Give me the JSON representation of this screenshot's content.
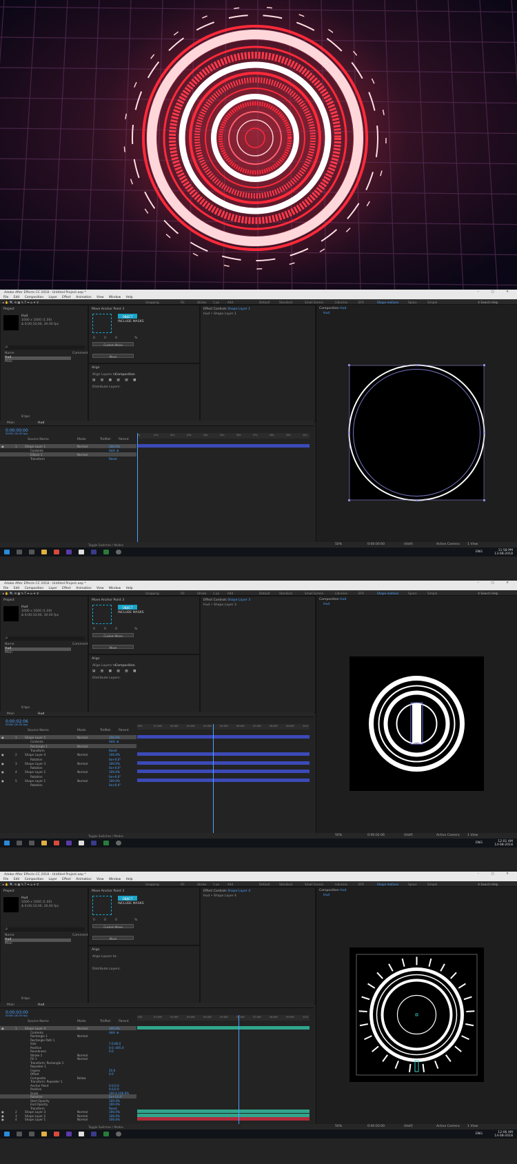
{
  "window_title": "Adobe After Effects CC 2018 - Untitled Project.aep *",
  "menu": [
    "File",
    "Edit",
    "Composition",
    "Layer",
    "Effect",
    "Animation",
    "View",
    "Window",
    "Help"
  ],
  "toolbar": {
    "snapping": "Snapping",
    "fill": "Fill",
    "stroke": "Stroke",
    "stroke_width": "1 px",
    "add": "Add"
  },
  "workspaces": [
    "Default",
    "Standard",
    "Small Screen",
    "Libraries",
    "EFX",
    "Shape motions",
    "Space",
    "Simple"
  ],
  "search_placeholder": "Search Help",
  "project": {
    "tab": "Project",
    "comp_name": "Hud",
    "comp_info": "1000 x 1000 (1.00)",
    "comp_dur": "Δ 0;00;10;00, 30.00 fps",
    "search": "ρ.",
    "col_name": "Name",
    "col_comment": "Comment",
    "items": [
      "Hud",
      "Main"
    ],
    "bpc": "8 bpc"
  },
  "anchor": {
    "title": "Move Anchor Point 3",
    "object": "OBJECT",
    "include_masks": "INCLUDE MASKS",
    "x": "0",
    "y": "0",
    "z": "0",
    "pct": "%",
    "custom": "Custom Move",
    "move": "Move"
  },
  "align": {
    "title": "Align",
    "align_to": "Align Layers to:",
    "composition": "Composition",
    "distribute": "Distribute Layers:"
  },
  "effect_controls": {
    "title": "Effect Controls",
    "shot1_layer": "Shape Layer 1",
    "shot2_layer": "Shape Layer 3",
    "shot3_layer": "Shape Layer 4",
    "shot1_sub": "Hud • Shape Layer 1",
    "shot2_sub": "Hud • Shape Layer 3",
    "shot3_sub": "Hud • Shape Layer 4"
  },
  "composition": {
    "title": "Composition",
    "comp": "Hud",
    "tab": "Hud"
  },
  "timeline": {
    "tabs": [
      "Main",
      "Hud"
    ],
    "col_source": "Source Name",
    "col_mode": "Mode",
    "col_trkmat": "TrkMat",
    "col_parent": "Parent",
    "shot1_time": "0:00:00:00",
    "shot2_time": "0:00:02:06",
    "shot3_time": "0:00:03:00",
    "fps_note": "00000 (30.00 fps)",
    "ruler": [
      "0s",
      "01s",
      "02s",
      "03s",
      "04s",
      "05s",
      "06s",
      "07s",
      "08s",
      "09s",
      "10s"
    ],
    "ruler2": [
      ":00f",
      "01:00f",
      "02:00f",
      "03:00f",
      "04:00f",
      "05:00f",
      "06:00f",
      "07:00f",
      "08:00f",
      "09:00f",
      "10:0"
    ],
    "toggle": "Toggle Switches / Modes"
  },
  "shot1_layers": [
    {
      "num": "1",
      "name": "Shape Layer 1",
      "mode": "Normal",
      "val": "100.0%",
      "sel": true
    },
    {
      "num": "",
      "name": "Contents",
      "mode": "",
      "val": "Add: ⊕",
      "sel": false
    },
    {
      "num": "",
      "name": "Ellipse 1",
      "mode": "Normal",
      "val": "",
      "sel": true
    },
    {
      "num": "",
      "name": "Transform",
      "mode": "",
      "val": "Reset",
      "sel": false
    }
  ],
  "shot2_layers": [
    {
      "num": "1",
      "name": "Shape Layer 5",
      "mode": "Normal",
      "val": "100.0%",
      "sel": true
    },
    {
      "num": "",
      "name": "Contents",
      "mode": "",
      "val": "Add: ⊕",
      "sel": false
    },
    {
      "num": "",
      "name": "Rectangle 1",
      "mode": "Normal",
      "val": "",
      "sel": true
    },
    {
      "num": "",
      "name": "Transform",
      "mode": "",
      "val": "Reset",
      "sel": false
    },
    {
      "num": "2",
      "name": "Shape Layer 4",
      "mode": "Normal",
      "val": "100.0%",
      "sel": false
    },
    {
      "num": "",
      "name": "Rotation",
      "mode": "",
      "val": "0x+0.0°",
      "sel": false
    },
    {
      "num": "3",
      "name": "Shape Layer 3",
      "mode": "Normal",
      "val": "100.0%",
      "sel": false
    },
    {
      "num": "",
      "name": "Rotation",
      "mode": "",
      "val": "0x+0.0°",
      "sel": false
    },
    {
      "num": "4",
      "name": "Shape Layer 2",
      "mode": "Normal",
      "val": "100.0%",
      "sel": false
    },
    {
      "num": "",
      "name": "Rotation",
      "mode": "",
      "val": "0x+0.0°",
      "sel": false
    },
    {
      "num": "5",
      "name": "Shape Layer 1",
      "mode": "Normal",
      "val": "100.0%",
      "sel": false
    },
    {
      "num": "",
      "name": "Rotation",
      "mode": "",
      "val": "0x+0.0°",
      "sel": false
    }
  ],
  "shot3_layers": [
    {
      "num": "1",
      "name": "Shape Layer 4",
      "mode": "Normal",
      "val": "100.0%",
      "sel": true
    },
    {
      "num": "",
      "name": "Contents",
      "mode": "",
      "val": "Add: ⊕",
      "sel": false
    },
    {
      "num": "",
      "name": "Rectangle 1",
      "mode": "Normal",
      "val": "",
      "sel": false
    },
    {
      "num": "",
      "name": "Rectangle Path 1",
      "mode": "",
      "val": "",
      "sel": false
    },
    {
      "num": "",
      "name": "Size",
      "mode": "",
      "val": "7.0,66.0",
      "sel": false
    },
    {
      "num": "",
      "name": "Position",
      "mode": "",
      "val": "0.0,-405.0",
      "sel": false
    },
    {
      "num": "",
      "name": "Roundness",
      "mode": "",
      "val": "0.0",
      "sel": false
    },
    {
      "num": "",
      "name": "Stroke 1",
      "mode": "Normal",
      "val": "",
      "sel": false
    },
    {
      "num": "",
      "name": "Fill 1",
      "mode": "Normal",
      "val": "",
      "sel": false
    },
    {
      "num": "",
      "name": "Transform: Rectangle 1",
      "mode": "",
      "val": "",
      "sel": false
    },
    {
      "num": "",
      "name": "Repeater 1",
      "mode": "",
      "val": "",
      "sel": false
    },
    {
      "num": "",
      "name": "Copies",
      "mode": "",
      "val": "25.0",
      "sel": false
    },
    {
      "num": "",
      "name": "Offset",
      "mode": "",
      "val": "0.0",
      "sel": false
    },
    {
      "num": "",
      "name": "Composite",
      "mode": "Below",
      "val": "",
      "sel": false
    },
    {
      "num": "",
      "name": "Transform: Repeater 1",
      "mode": "",
      "val": "",
      "sel": false
    },
    {
      "num": "",
      "name": "Anchor Point",
      "mode": "",
      "val": "0.0,0.0",
      "sel": false
    },
    {
      "num": "",
      "name": "Position",
      "mode": "",
      "val": "0.0,0.0",
      "sel": false
    },
    {
      "num": "",
      "name": "Scale",
      "mode": "",
      "val": "100.0,100.0%",
      "sel": false
    },
    {
      "num": "",
      "name": "Rotation",
      "mode": "",
      "val": "0x+14.4°",
      "sel": true
    },
    {
      "num": "",
      "name": "Start Opacity",
      "mode": "",
      "val": "100.0%",
      "sel": false
    },
    {
      "num": "",
      "name": "End Opacity",
      "mode": "",
      "val": "100.0%",
      "sel": false
    },
    {
      "num": "",
      "name": "Transform",
      "mode": "",
      "val": "Reset",
      "sel": false
    },
    {
      "num": "2",
      "name": "Shape Layer 3",
      "mode": "Normal",
      "val": "100.0%",
      "sel": false
    },
    {
      "num": "3",
      "name": "Shape Layer 2",
      "mode": "Normal",
      "val": "100.0%",
      "sel": false
    },
    {
      "num": "4",
      "name": "Shape Layer 1",
      "mode": "Normal",
      "val": "100.0%",
      "sel": false
    }
  ],
  "viewer_bar": {
    "zoom": "50%",
    "time1": "0:00:00:00",
    "time2": "0:00:02:06",
    "time3": "0:00:03:00",
    "res": "(Half)",
    "camera": "Active Camera",
    "view": "1 View"
  },
  "taskbar": {
    "clock1": "11:58 PM",
    "date1": "13-08-2018",
    "clock2": "12:01 AM",
    "date2": "14-08-2018",
    "clock3": "12:06 AM",
    "date3": "14-08-2018",
    "lang": "ENG"
  },
  "colors": {
    "accent": "#4da3ff",
    "layer_blue": "#3c4ab8",
    "layer_green": "#2fa58c",
    "layer_red": "#b02c3c",
    "hud_red": "#ff2a3a"
  }
}
